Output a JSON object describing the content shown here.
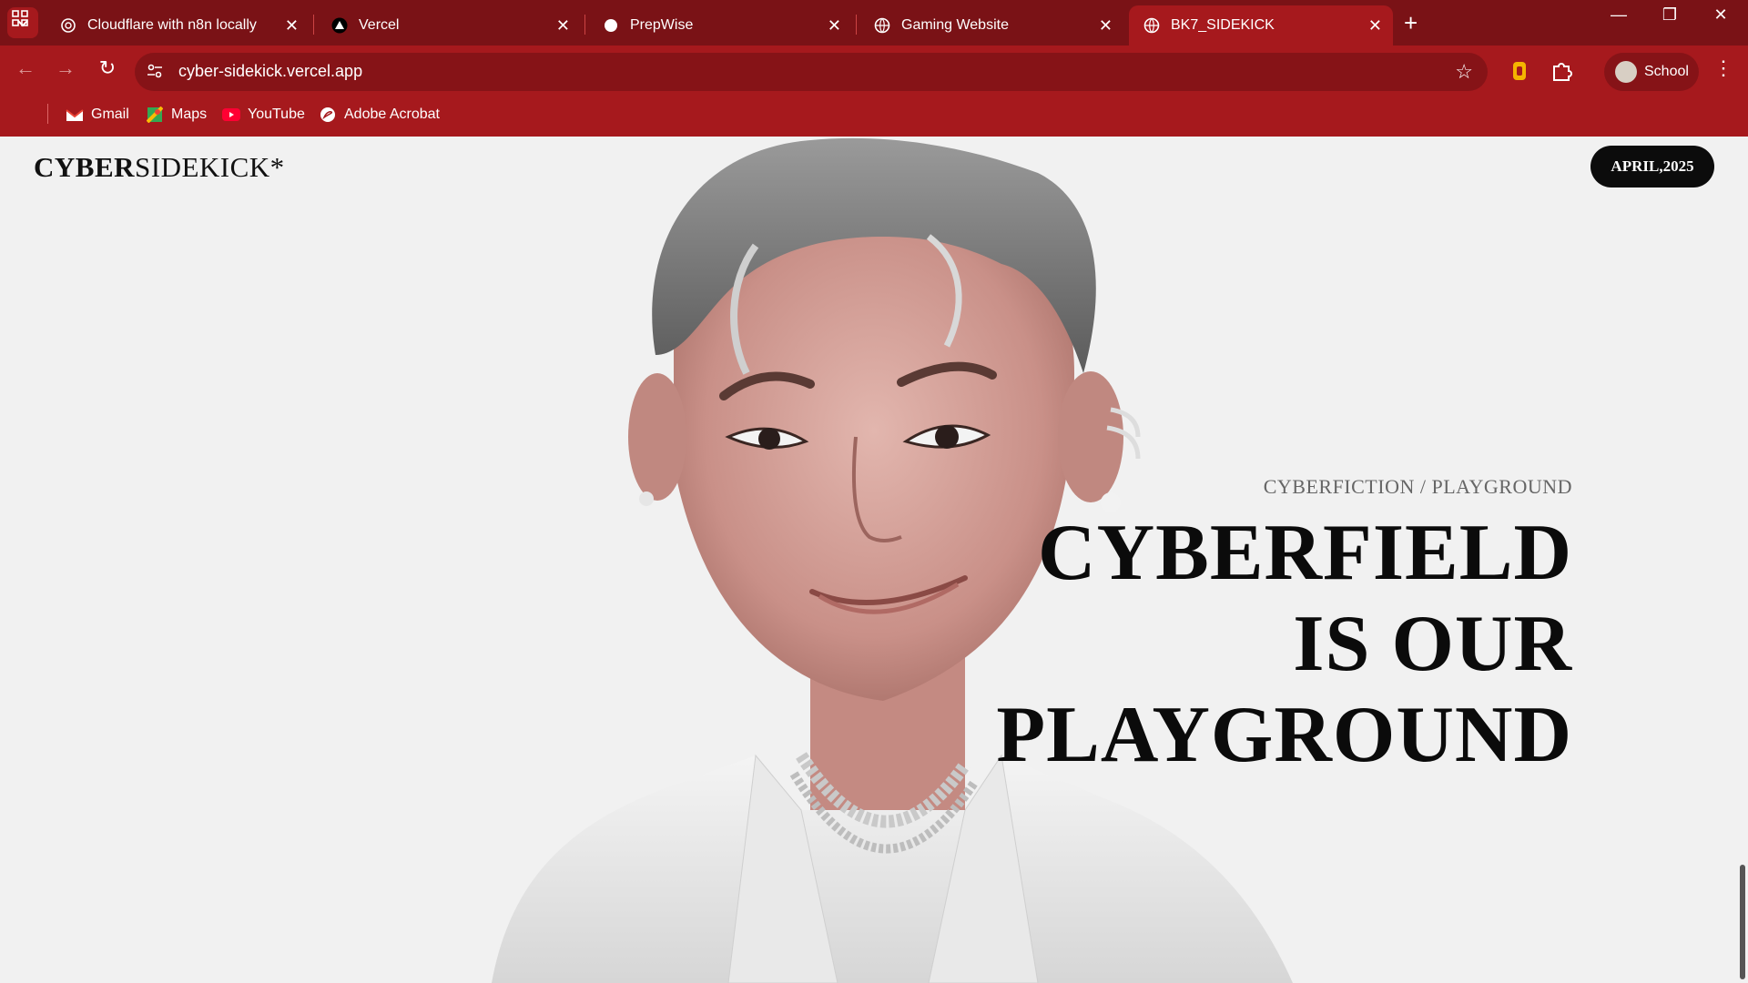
{
  "browser": {
    "tabs": [
      {
        "title": "Cloudflare with n8n locally",
        "icon": "openai-icon"
      },
      {
        "title": "Vercel",
        "icon": "vercel-icon"
      },
      {
        "title": "PrepWise",
        "icon": "prepwise-icon"
      },
      {
        "title": "Gaming Website",
        "icon": "globe-icon"
      },
      {
        "title": "BK7_SIDEKICK",
        "icon": "globe-icon",
        "active": true
      }
    ],
    "url": "cyber-sidekick.vercel.app",
    "profile": "School",
    "bookmarks": [
      {
        "label": "Gmail",
        "icon": "gmail-icon"
      },
      {
        "label": "Maps",
        "icon": "maps-icon"
      },
      {
        "label": "YouTube",
        "icon": "youtube-icon"
      },
      {
        "label": "Adobe Acrobat",
        "icon": "acrobat-icon"
      }
    ],
    "theme_color": "#a6191d"
  },
  "site": {
    "logo_bold": "CYBER",
    "logo_thin": "SIDEKICK*",
    "date_badge": "APRIL,2025",
    "hero_sub": "CYBERFICTION / PLAYGROUND",
    "hero_lines": [
      "CYBERFIELD",
      "IS OUR",
      "PLAYGROUND"
    ]
  }
}
